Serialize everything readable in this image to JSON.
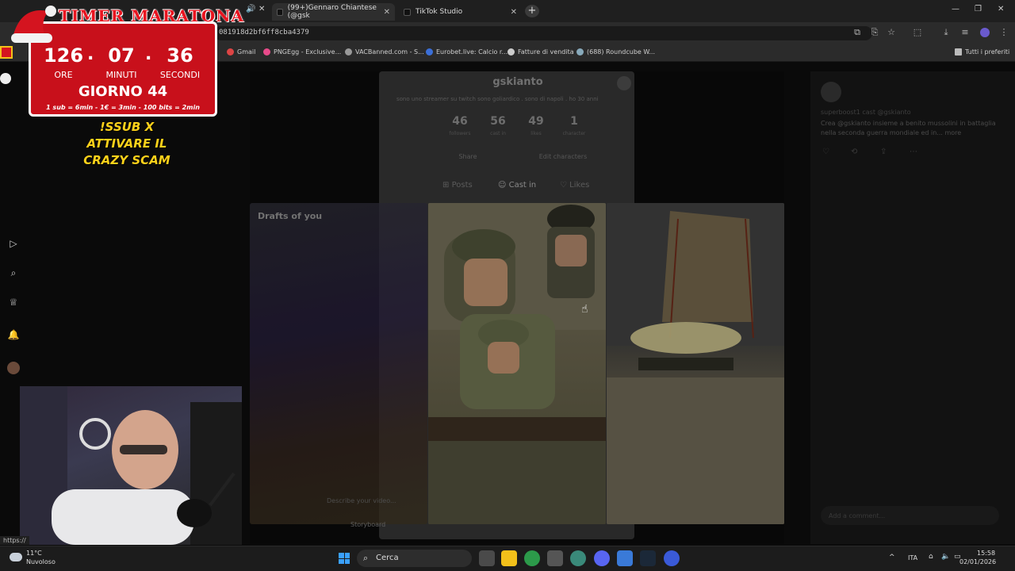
{
  "browser": {
    "tabs": [
      {
        "label": "(99+)Gennaro Chiantese (@gsk"
      },
      {
        "label": "TikTok Studio"
      }
    ],
    "url": "081918d2bf6ff8cba4379",
    "bookmarks": [
      "Gmail",
      "PNGEgg - Exclusive...",
      "VACBanned.com - S...",
      "Eurobet.live: Calcio r...",
      "Fatture di vendita",
      "(688) Roundcube W...",
      "Tutti i preferiti"
    ],
    "status_url": "https://"
  },
  "profile": {
    "name": "gskianto",
    "bio": "sono uno streamer su twitch sono goliardico . sono di napoli . ho 30 anni",
    "stats": [
      {
        "value": "46",
        "label": "followers"
      },
      {
        "value": "56",
        "label": "cast in"
      },
      {
        "value": "49",
        "label": "likes"
      },
      {
        "value": "1",
        "label": "character"
      }
    ],
    "share_label": "Share",
    "edit_label": "Edit characters",
    "tabs": [
      "Posts",
      "Cast in",
      "Likes"
    ]
  },
  "feed": {
    "drafts_title": "Drafts of you",
    "describe_placeholder": "Describe your video...",
    "storyboard_label": "Storyboard"
  },
  "comments": {
    "user": "superboost1",
    "cast": "cast @gskianto",
    "text": "Crea @gskianto insieme a benito mussolini in battaglia nella seconda guerra mondiale ed in...",
    "more": "more",
    "add_placeholder": "Add a comment..."
  },
  "overlay": {
    "title": "TIMER MARATONA",
    "hours": "126",
    "minutes": "07",
    "seconds": "36",
    "hours_label": "ORE",
    "minutes_label": "MINUTI",
    "seconds_label": "SECONDI",
    "day": "GIORNO 44",
    "rates": "1 sub = 6min - 1€ = 3min - 100 bits = 2min",
    "sub_line1": "!SSUB X",
    "sub_line2": "ATTIVARE IL",
    "sub_line3": "CRAZY SCAM"
  },
  "taskbar": {
    "weather_temp": "11°C",
    "weather_desc": "Nuvoloso",
    "search_label": "Cerca",
    "language": "ITA",
    "time": "15:58",
    "date": "02/01/2026"
  },
  "colors": {
    "timer_red": "#c8101b",
    "sub_yellow": "#ffd21a"
  }
}
